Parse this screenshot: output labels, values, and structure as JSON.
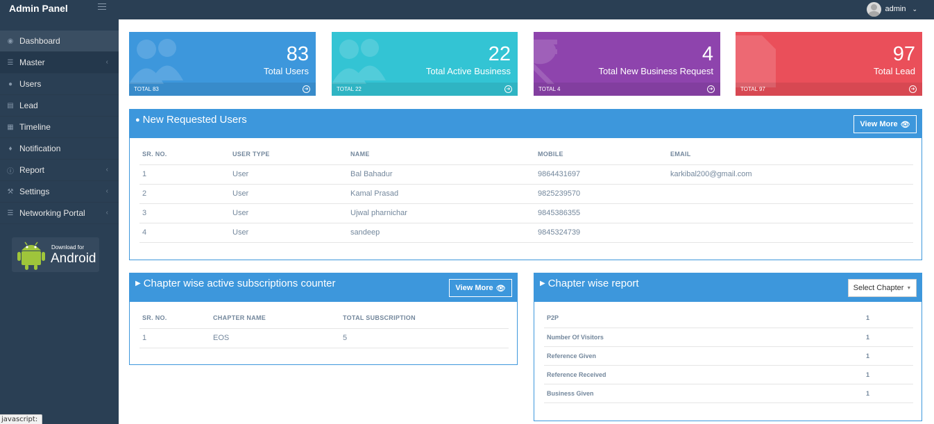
{
  "app": {
    "title": "Admin Panel",
    "user": "admin"
  },
  "sidebar": {
    "items": [
      {
        "label": "Dashboard",
        "icon": "dashboard-icon",
        "has_arrow": false,
        "active": true
      },
      {
        "label": "Master",
        "icon": "list-icon",
        "has_arrow": true
      },
      {
        "label": "Users",
        "icon": "users-icon",
        "has_arrow": false
      },
      {
        "label": "Lead",
        "icon": "list-alt-icon",
        "has_arrow": false
      },
      {
        "label": "Timeline",
        "icon": "bar-chart-icon",
        "has_arrow": false
      },
      {
        "label": "Notification",
        "icon": "bell-icon",
        "has_arrow": false
      },
      {
        "label": "Report",
        "icon": "info-icon",
        "has_arrow": true
      },
      {
        "label": "Settings",
        "icon": "wrench-icon",
        "has_arrow": true
      },
      {
        "label": "Networking Portal",
        "icon": "list-icon",
        "has_arrow": true
      }
    ],
    "android": {
      "small": "Download for",
      "big": "Android"
    }
  },
  "tiles": [
    {
      "value": "83",
      "label": "Total Users",
      "footer": "TOTAL 83",
      "color": "#3d97dc"
    },
    {
      "value": "22",
      "label": "Total Active Business",
      "footer": "TOTAL 22",
      "color": "#33c4d4"
    },
    {
      "value": "4",
      "label": "Total New Business Request",
      "footer": "TOTAL 4",
      "color": "#8e44ad"
    },
    {
      "value": "97",
      "label": "Total Lead",
      "footer": "TOTAL 97",
      "color": "#ea4f5a"
    }
  ],
  "requested_users": {
    "title": "New Requested Users",
    "view_more": "View More",
    "columns": [
      "SR. NO.",
      "USER TYPE",
      "NAME",
      "MOBILE",
      "EMAIL"
    ],
    "rows": [
      [
        "1",
        "User",
        "Bal Bahadur",
        "9864431697",
        "karkibal200@gmail.com"
      ],
      [
        "2",
        "User",
        "Kamal Prasad",
        "9825239570",
        ""
      ],
      [
        "3",
        "User",
        "Ujwal pharnichar",
        "9845386355",
        ""
      ],
      [
        "4",
        "User",
        "sandeep",
        "9845324739",
        ""
      ]
    ]
  },
  "chapter_counter": {
    "title": "Chapter wise active subscriptions counter",
    "view_more": "View More",
    "columns": [
      "SR. NO.",
      "CHAPTER NAME",
      "TOTAL SUBSCRIPTION"
    ],
    "rows": [
      [
        "1",
        "EOS",
        "5"
      ]
    ]
  },
  "chapter_report": {
    "title": "Chapter wise report",
    "select_label": "Select Chapter",
    "rows": [
      [
        "P2P",
        "1"
      ],
      [
        "Number Of Visitors",
        "1"
      ],
      [
        "Reference Given",
        "1"
      ],
      [
        "Reference Received",
        "1"
      ],
      [
        "Business Given",
        "1"
      ]
    ]
  },
  "status_bar": "javascript:"
}
